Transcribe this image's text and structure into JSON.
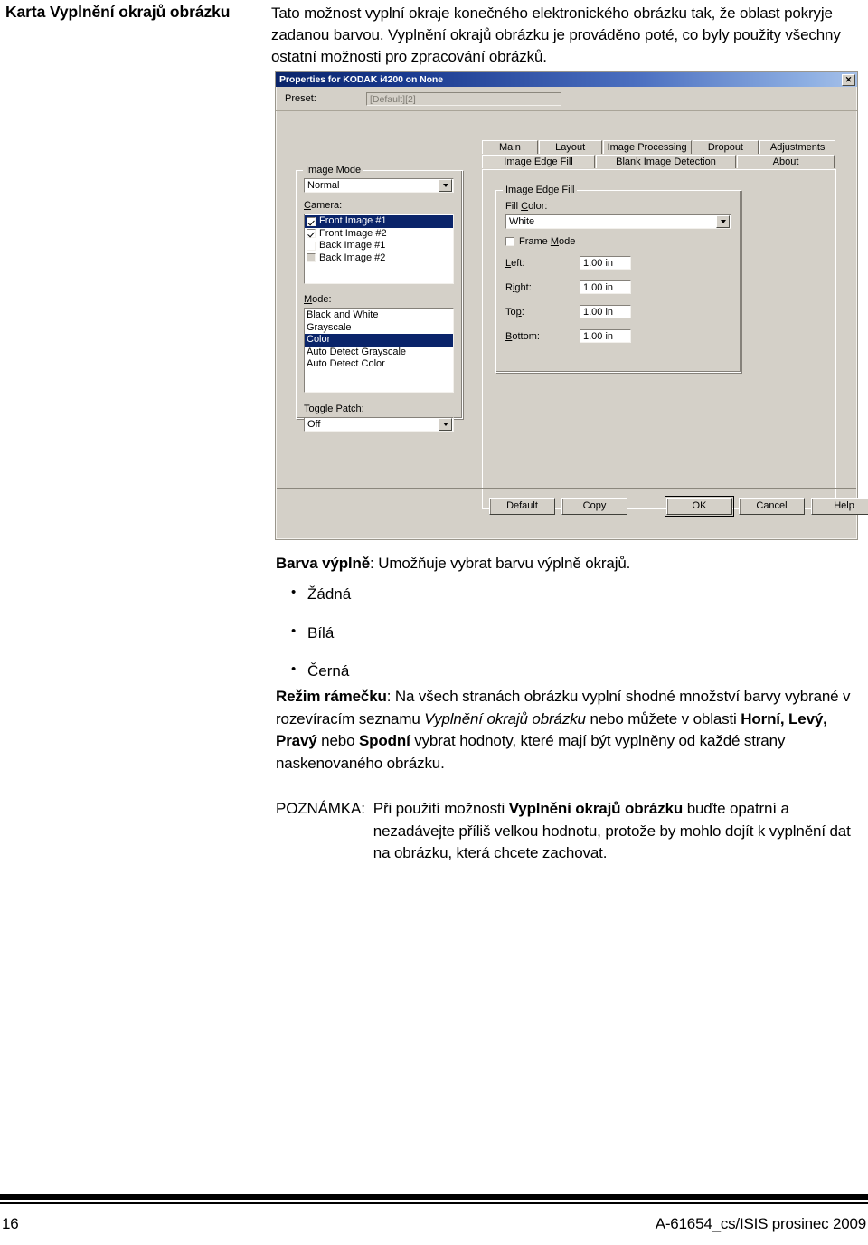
{
  "document": {
    "heading": "Karta Vyplnění okrajů obrázku",
    "intro": "Tato možnost vyplní okraje konečného elektronického obrázku tak, že oblast pokryje zadanou barvou. Vyplnění okrajů obrázku je prováděno poté, co byly použity všechny ostatní možnosti pro zpracování obrázků."
  },
  "dialog": {
    "title": "Properties for KODAK i4200 on None",
    "close_icon": "close-icon",
    "preset": {
      "label": "Preset:",
      "value": "[Default][2]"
    },
    "image_mode": {
      "legend": "Image Mode",
      "combo_value": "Normal",
      "camera_label": "Camera:",
      "camera_items": [
        {
          "label": "Front Image #1",
          "checked": true,
          "selected": true,
          "disabled": false
        },
        {
          "label": "Front Image #2",
          "checked": true,
          "selected": false,
          "disabled": false
        },
        {
          "label": "Back Image #1",
          "checked": false,
          "selected": false,
          "disabled": false
        },
        {
          "label": "Back Image #2",
          "checked": false,
          "selected": false,
          "disabled": true
        }
      ],
      "mode_label": "Mode:",
      "mode_items": [
        {
          "label": "Black and White",
          "selected": false
        },
        {
          "label": "Grayscale",
          "selected": false
        },
        {
          "label": "Color",
          "selected": true
        },
        {
          "label": "Auto Detect Grayscale",
          "selected": false
        },
        {
          "label": "Auto Detect Color",
          "selected": false
        }
      ],
      "toggle_patch_label": "Toggle Patch:",
      "toggle_patch_value": "Off"
    },
    "tabs_row1": [
      {
        "label": "Main",
        "active": false
      },
      {
        "label": "Layout",
        "active": false
      },
      {
        "label": "Image Processing",
        "active": false
      },
      {
        "label": "Dropout",
        "active": false
      },
      {
        "label": "Adjustments",
        "active": false
      }
    ],
    "tabs_row2": [
      {
        "label": "Image Edge Fill",
        "active": true
      },
      {
        "label": "Blank Image Detection",
        "active": false
      },
      {
        "label": "About",
        "active": false
      }
    ],
    "edge_fill": {
      "legend": "Image Edge Fill",
      "fill_color_label": "Fill Color:",
      "fill_color_value": "White",
      "frame_mode_label": "Frame Mode",
      "frame_mode_checked": false,
      "fields": [
        {
          "label": "Left:",
          "value": "1.00 in"
        },
        {
          "label": "Right:",
          "value": "1.00 in"
        },
        {
          "label": "Top:",
          "value": "1.00 in"
        },
        {
          "label": "Bottom:",
          "value": "1.00 in"
        }
      ]
    },
    "buttons": [
      {
        "label": "Default",
        "default": false
      },
      {
        "label": "Copy",
        "default": false
      },
      {
        "label": "OK",
        "default": true
      },
      {
        "label": "Cancel",
        "default": false
      },
      {
        "label": "Help",
        "default": false
      }
    ],
    "colors": {
      "titlebar_start": "#0a246a",
      "titlebar_end": "#a6c0e8",
      "face": "#d4d0c8",
      "selection": "#0a246a"
    }
  },
  "content": {
    "fill_color_heading_bold": "Barva výplně",
    "fill_color_heading_rest": ": Umožňuje vybrat barvu výplně okrajů.",
    "fill_color_options": [
      "Žádná",
      "Bílá",
      "Černá"
    ],
    "frame_mode_paragraph": {
      "bold_lead": "Režim rámečku",
      "part1": ": Na všech stranách obrázku vyplní shodné množství barvy vybrané v rozevíracím seznamu ",
      "italic1": "Vyplnění okrajů obrázku",
      "part2": " nebo můžete v oblasti ",
      "bold1": "Horní, Levý, Pravý",
      "part3": " nebo ",
      "bold2": "Spodní",
      "part4": " vybrat hodnoty, které mají být vyplněny od každé strany naskenovaného obrázku."
    },
    "note": {
      "label": "POZNÁMKA:",
      "part1": "Při použití možnosti ",
      "bold": "Vyplnění okrajů obrázku",
      "part2": " buďte opatrní a nezadávejte příliš velkou hodnotu, protože by mohlo dojít k vyplnění dat na obrázku, která chcete zachovat."
    }
  },
  "footer": {
    "page_number": "16",
    "reference": "A-61654_cs/ISIS  prosinec 2009"
  }
}
